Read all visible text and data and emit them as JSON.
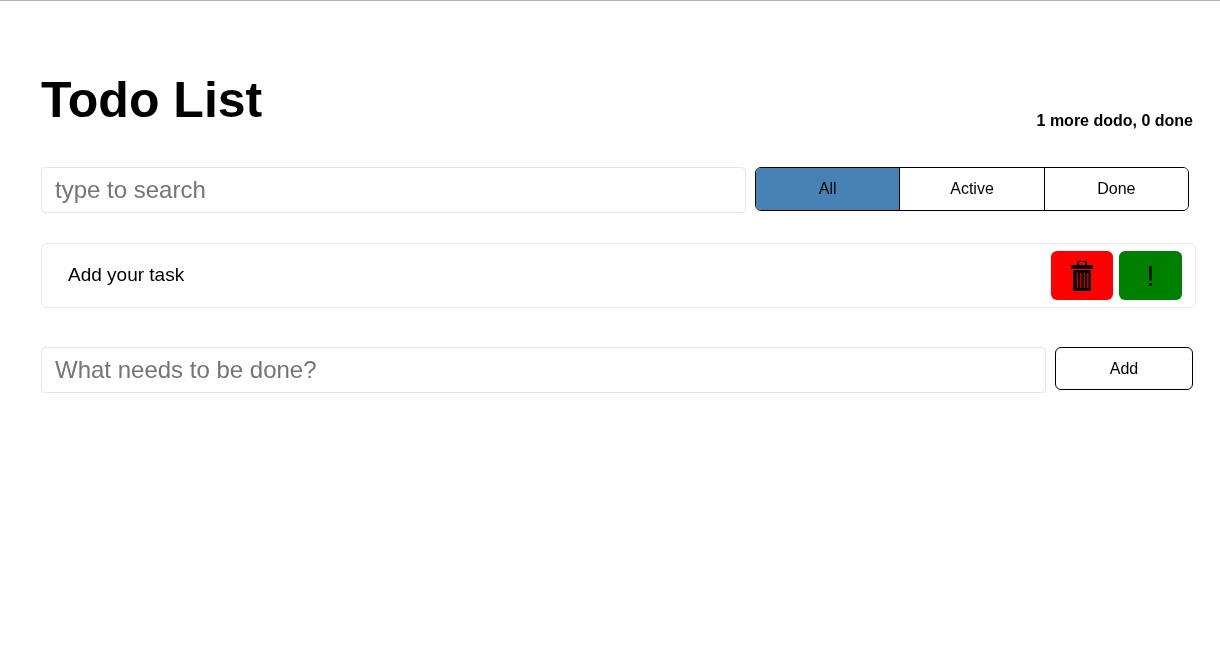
{
  "header": {
    "title": "Todo List",
    "status": "1 more dodo, 0 done"
  },
  "search": {
    "placeholder": "type to search"
  },
  "filters": [
    {
      "label": "All",
      "selected": true
    },
    {
      "label": "Active",
      "selected": false
    },
    {
      "label": "Done",
      "selected": false
    }
  ],
  "tasks": [
    {
      "label": "Add your task",
      "important_button": "!"
    }
  ],
  "add_form": {
    "placeholder": "What needs to be done?",
    "button": "Add"
  }
}
